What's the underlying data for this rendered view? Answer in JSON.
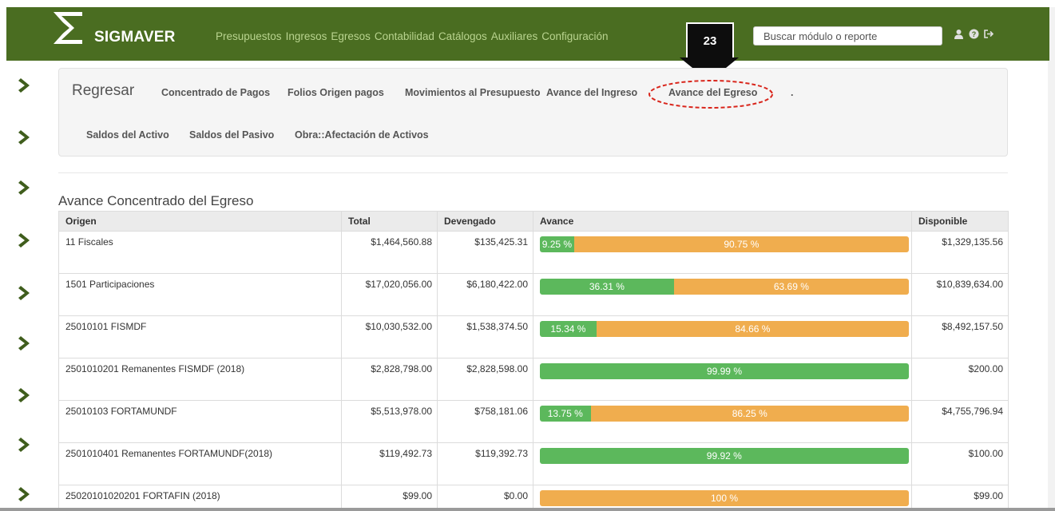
{
  "header": {
    "brand": "SIGMAVER",
    "menu": [
      "Presupuestos",
      "Ingresos",
      "Egresos",
      "Contabilidad",
      "Catálogos",
      "Auxiliares",
      "Configuración"
    ],
    "search_placeholder": "Buscar módulo o reporte",
    "icons": [
      "user-icon",
      "help-icon",
      "logout-icon"
    ]
  },
  "step_marker": {
    "number": "23"
  },
  "submenu": {
    "back": "Regresar",
    "row1": [
      "Concentrado de Pagos",
      "Folios Origen pagos",
      "Movimientos al Presupuesto",
      "Avance del Ingreso",
      "Avance del Egreso",
      "."
    ],
    "row2": [
      "Saldos del Activo",
      "Saldos del Pasivo",
      "Obra::Afectación de Activos"
    ],
    "highlighted": "Avance del Egreso"
  },
  "section_title": "Avance Concentrado del Egreso",
  "table": {
    "headers": [
      "Origen",
      "Total",
      "Devengado",
      "Avance",
      "Disponible"
    ],
    "rows": [
      {
        "origen": "11 Fiscales",
        "total": "$1,464,560.88",
        "devengado": "$135,425.31",
        "avance_pct": 9.25,
        "avance_label": "9.25 %",
        "rest_label": "90.75 %",
        "disponible": "$1,329,135.56"
      },
      {
        "origen": "1501 Participaciones",
        "total": "$17,020,056.00",
        "devengado": "$6,180,422.00",
        "avance_pct": 36.31,
        "avance_label": "36.31 %",
        "rest_label": "63.69 %",
        "disponible": "$10,839,634.00"
      },
      {
        "origen": "25010101 FISMDF",
        "total": "$10,030,532.00",
        "devengado": "$1,538,374.50",
        "avance_pct": 15.34,
        "avance_label": "15.34 %",
        "rest_label": "84.66 %",
        "disponible": "$8,492,157.50"
      },
      {
        "origen": "2501010201 Remanentes FISMDF (2018)",
        "total": "$2,828,798.00",
        "devengado": "$2,828,598.00",
        "avance_pct": 99.99,
        "avance_label": "99.99 %",
        "rest_label": "",
        "disponible": "$200.00"
      },
      {
        "origen": "25010103 FORTAMUNDF",
        "total": "$5,513,978.00",
        "devengado": "$758,181.06",
        "avance_pct": 13.75,
        "avance_label": "13.75 %",
        "rest_label": "86.25 %",
        "disponible": "$4,755,796.94"
      },
      {
        "origen": "2501010401 Remanentes FORTAMUNDF(2018)",
        "total": "$119,492.73",
        "devengado": "$119,392.73",
        "avance_pct": 99.92,
        "avance_label": "99.92 %",
        "rest_label": "",
        "disponible": "$100.00"
      },
      {
        "origen": "25020101020201 FORTAFIN (2018)",
        "total": "$99.00",
        "devengado": "$0.00",
        "avance_pct": 0,
        "avance_label": "",
        "rest_label": "100 %",
        "disponible": "$99.00"
      }
    ]
  },
  "colors": {
    "navbar": "#4a6d21",
    "menu_text": "#b9d48f",
    "progress_done": "#5cb85c",
    "progress_remaining": "#f0ad4e",
    "highlight_ring": "#d9261c"
  }
}
